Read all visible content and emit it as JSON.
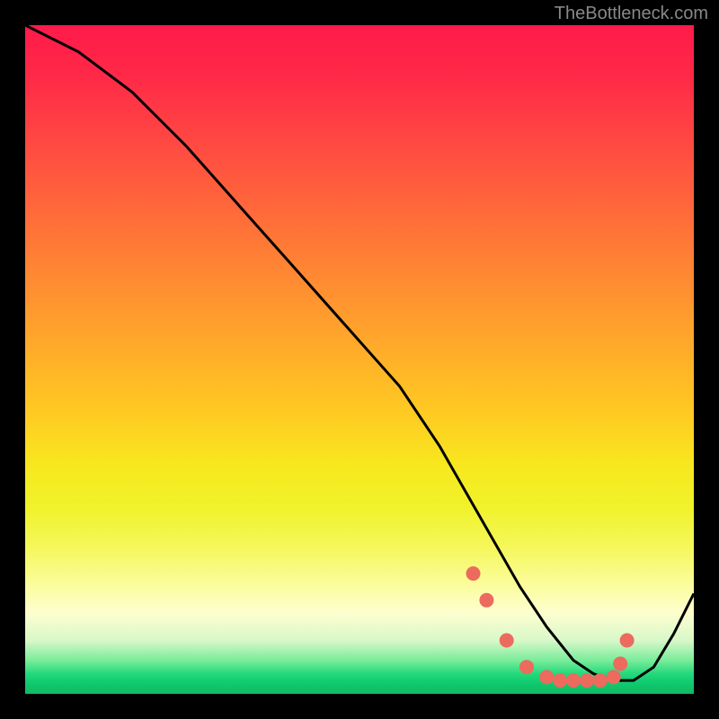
{
  "attribution": "TheBottleneck.com",
  "chart_data": {
    "type": "line",
    "title": "",
    "xlabel": "",
    "ylabel": "",
    "xlim": [
      0,
      100
    ],
    "ylim": [
      0,
      100
    ],
    "series": [
      {
        "name": "curve",
        "x": [
          0,
          8,
          16,
          24,
          32,
          40,
          48,
          56,
          62,
          66,
          70,
          74,
          78,
          82,
          85,
          88,
          91,
          94,
          97,
          100
        ],
        "y": [
          100,
          96,
          90,
          82,
          73,
          64,
          55,
          46,
          37,
          30,
          23,
          16,
          10,
          5,
          3,
          2,
          2,
          4,
          9,
          15
        ]
      }
    ],
    "markers": {
      "name": "dots",
      "x": [
        67,
        69,
        72,
        75,
        78,
        80,
        82,
        84,
        86,
        88,
        89,
        90
      ],
      "y": [
        18,
        14,
        8,
        4,
        2.5,
        2,
        2,
        2,
        2,
        2.5,
        4.5,
        8
      ]
    },
    "colors": {
      "line": "#000000",
      "marker": "#ec6a5e"
    }
  }
}
